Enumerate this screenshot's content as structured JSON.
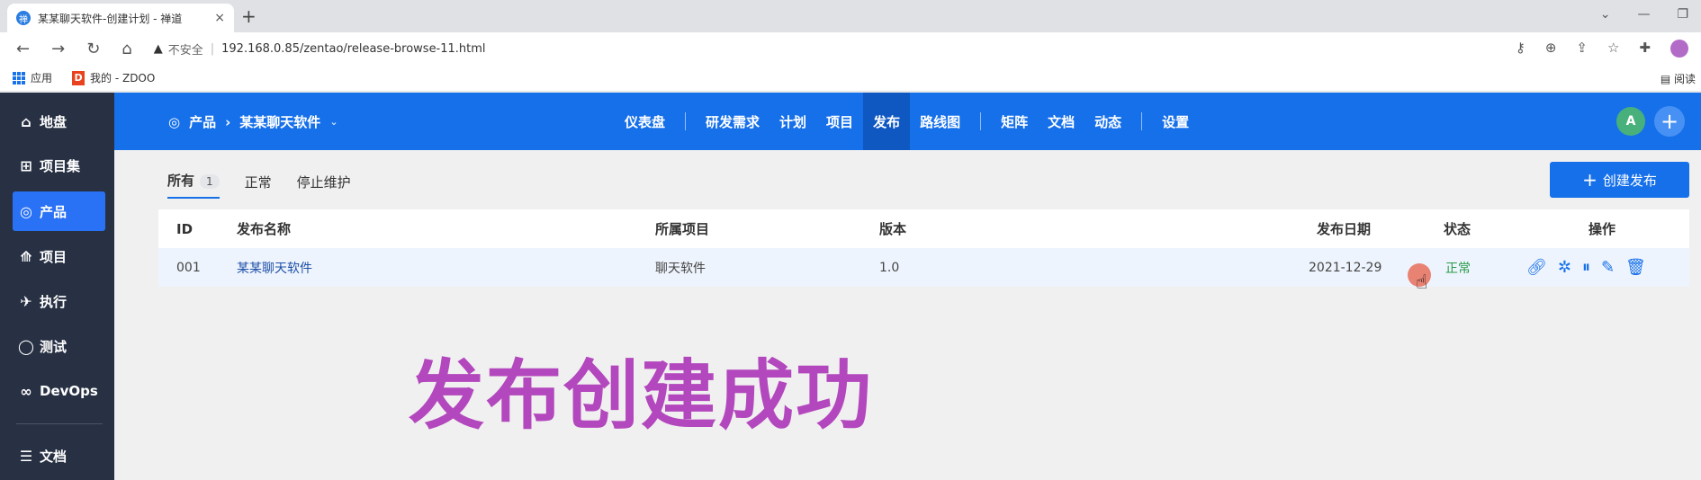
{
  "browser": {
    "tab_title": "某某聊天软件-创建计划 - 禅道",
    "tab_close": "×",
    "new_tab": "+",
    "url_warning": "▲",
    "not_secure": "不安全",
    "url": "192.168.0.85/zentao/release-browse-11.html",
    "bookmarks": [
      "应用",
      "我的 - ZDOO"
    ],
    "reader_mode": "阅读"
  },
  "sidebar": {
    "items": [
      {
        "label": "地盘",
        "icon": "home-icon",
        "glyph": "⌂"
      },
      {
        "label": "项目集",
        "icon": "grid-icon",
        "glyph": "⊞"
      },
      {
        "label": "产品",
        "icon": "bulb-icon",
        "glyph": "◎"
      },
      {
        "label": "项目",
        "icon": "rocket-icon",
        "glyph": "⟰"
      },
      {
        "label": "执行",
        "icon": "run-icon",
        "glyph": "✈"
      },
      {
        "label": "测试",
        "icon": "search-icon",
        "glyph": "◯"
      },
      {
        "label": "DevOps",
        "icon": "infinity-icon",
        "glyph": "∞"
      },
      {
        "label": "文档",
        "icon": "doc-icon",
        "glyph": "☰"
      }
    ],
    "active_index": 2
  },
  "topnav": {
    "breadcrumb_root": "产品",
    "breadcrumb_sep": "›",
    "product_name": "某某聊天软件",
    "caret": "⌄",
    "items": [
      "仪表盘",
      "研发需求",
      "计划",
      "项目",
      "发布",
      "路线图",
      "矩阵",
      "文档",
      "动态",
      "设置"
    ],
    "active_item": "发布",
    "avatar_initial": "A",
    "plus": "+"
  },
  "subtabs": {
    "all": "所有",
    "all_count": "1",
    "normal": "正常",
    "terminated": "停止维护"
  },
  "create_button": {
    "plus": "+",
    "label": "创建发布"
  },
  "table": {
    "headers": {
      "id": "ID",
      "name": "发布名称",
      "project": "所属项目",
      "build": "版本",
      "date": "发布日期",
      "status": "状态",
      "actions": "操作"
    },
    "rows": [
      {
        "id": "001",
        "name": "某某聊天软件",
        "project": "聊天软件",
        "build": "1.0",
        "date": "2021-12-29",
        "status": "正常"
      }
    ]
  },
  "overlay_caption": "发布创建成功",
  "colors": {
    "accent": "#1670ea",
    "sidebar": "#283144",
    "caption": "#b347bd",
    "status_ok": "#2a9a4c"
  }
}
